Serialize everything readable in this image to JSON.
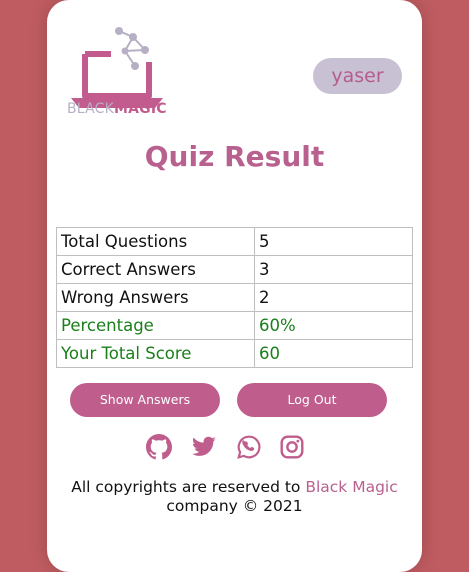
{
  "logo": {
    "text_light": "BLACK",
    "text_bold": "MAGIC"
  },
  "user": {
    "name": "yaser"
  },
  "title": "Quiz Result",
  "results": [
    {
      "label": "Total Questions",
      "value": "5"
    },
    {
      "label": "Correct Answers",
      "value": "3"
    },
    {
      "label": "Wrong Answers",
      "value": "2"
    },
    {
      "label": "Percentage",
      "value": "60%"
    },
    {
      "label": "Your Total Score",
      "value": "60"
    }
  ],
  "buttons": {
    "show_answers": "Show Answers",
    "logout": "Log Out"
  },
  "social_icons": [
    "github-icon",
    "twitter-icon",
    "whatsapp-icon",
    "instagram-icon"
  ],
  "footer": {
    "prefix": "All copyrights are reserved to",
    "brand": "Black Magic",
    "suffix": "company © 2021"
  },
  "colors": {
    "background": "#bf5c61",
    "accent": "#bf5e8d",
    "highlight_green": "#1a7f1a",
    "badge_bg": "#c8c1d4"
  }
}
